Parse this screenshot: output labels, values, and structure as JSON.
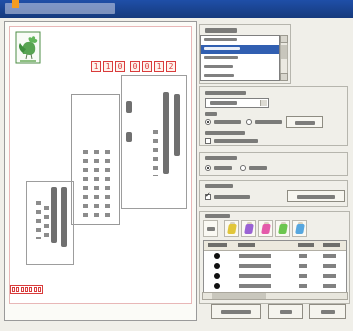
{
  "window": {
    "title": ""
  },
  "postcard": {
    "postal_code_recipient": [
      "1",
      "1",
      "0",
      "0",
      "0",
      "1",
      "2"
    ]
  },
  "colors": {
    "title_bar": "#1f4fa8",
    "accent_red": "#d93c3c",
    "stamp_green": "#4d8e45",
    "selection_blue": "#315fb1"
  },
  "icons": {
    "stamp": "rooster-stamp-icon",
    "scroll_up": "scroll-up-icon",
    "scroll_down": "scroll-down-icon",
    "tab_tags": "tag-icon"
  }
}
